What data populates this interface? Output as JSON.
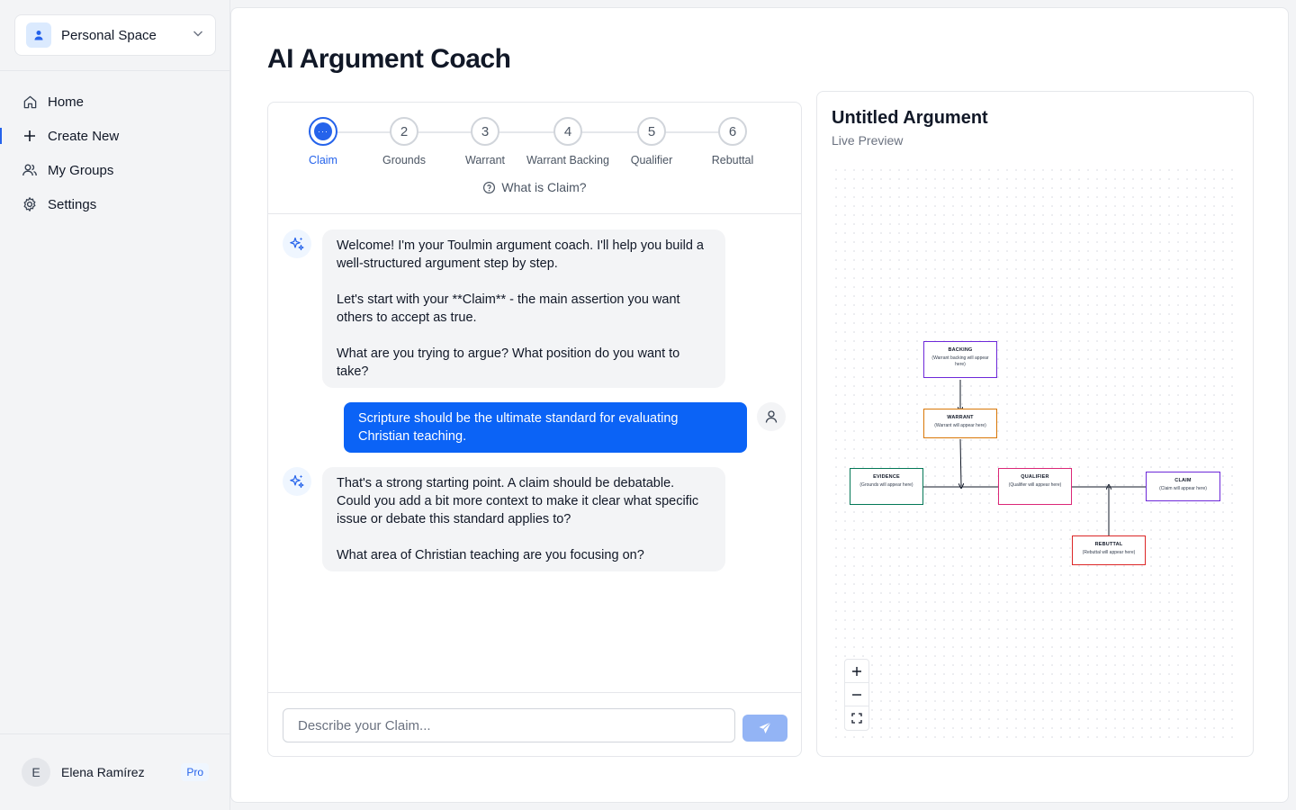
{
  "sidebar": {
    "space_label": "Personal Space",
    "items": [
      {
        "label": "Home",
        "icon": "home-icon"
      },
      {
        "label": "Create New",
        "icon": "plus-icon"
      },
      {
        "label": "My Groups",
        "icon": "users-icon"
      },
      {
        "label": "Settings",
        "icon": "gear-icon"
      }
    ],
    "active_item": "Create New",
    "user": {
      "initial": "E",
      "name": "Elena Ramírez",
      "badge": "Pro"
    }
  },
  "main": {
    "title": "AI Argument Coach"
  },
  "stepper": {
    "steps": [
      {
        "number": "···",
        "label": "Claim"
      },
      {
        "number": "2",
        "label": "Grounds"
      },
      {
        "number": "3",
        "label": "Warrant"
      },
      {
        "number": "4",
        "label": "Warrant Backing"
      },
      {
        "number": "5",
        "label": "Qualifier"
      },
      {
        "number": "6",
        "label": "Rebuttal"
      }
    ],
    "active_step": "Claim",
    "help_text": "What is Claim?"
  },
  "chat": {
    "messages": [
      {
        "role": "assistant",
        "text": "Welcome! I'm your Toulmin argument coach. I'll help you build a well-structured argument step by step.\n\nLet's start with your **Claim** - the main assertion you want others to accept as true.\n\nWhat are you trying to argue? What position do you want to take?"
      },
      {
        "role": "user",
        "text": "Scripture should be the ultimate standard for evaluating Christian teaching."
      },
      {
        "role": "assistant",
        "text": "That's a strong starting point. A claim should be debatable. Could you add a bit more context to make it clear what specific issue or debate this standard applies to?\n\nWhat area of Christian teaching are you focusing on?"
      }
    ],
    "input_placeholder": "Describe your Claim...",
    "input_value": ""
  },
  "preview": {
    "title": "Untitled Argument",
    "subtitle": "Live Preview",
    "nodes": {
      "backing": {
        "title": "BACKING",
        "body": "(Warrant backing will appear here)",
        "color": "#6d28d9"
      },
      "warrant": {
        "title": "WARRANT",
        "body": "(Warrant will appear here)",
        "color": "#d97706"
      },
      "evidence": {
        "title": "EVIDENCE",
        "body": "(Grounds will appear here)",
        "color": "#047857"
      },
      "qualifier": {
        "title": "QUALIFIER",
        "body": "(Qualifier will appear here)",
        "color": "#db2777"
      },
      "claim": {
        "title": "CLAIM",
        "body": "(Claim will appear here)",
        "color": "#6d28d9"
      },
      "rebuttal": {
        "title": "REBUTTAL",
        "body": "(Rebuttal will appear here)",
        "color": "#dc2626"
      }
    },
    "zoom_controls": [
      "zoom-in",
      "zoom-out",
      "fit-view"
    ]
  },
  "colors": {
    "accent": "#2563eb",
    "user_bubble": "#0b63f6",
    "send_button": "#93b4f5"
  }
}
